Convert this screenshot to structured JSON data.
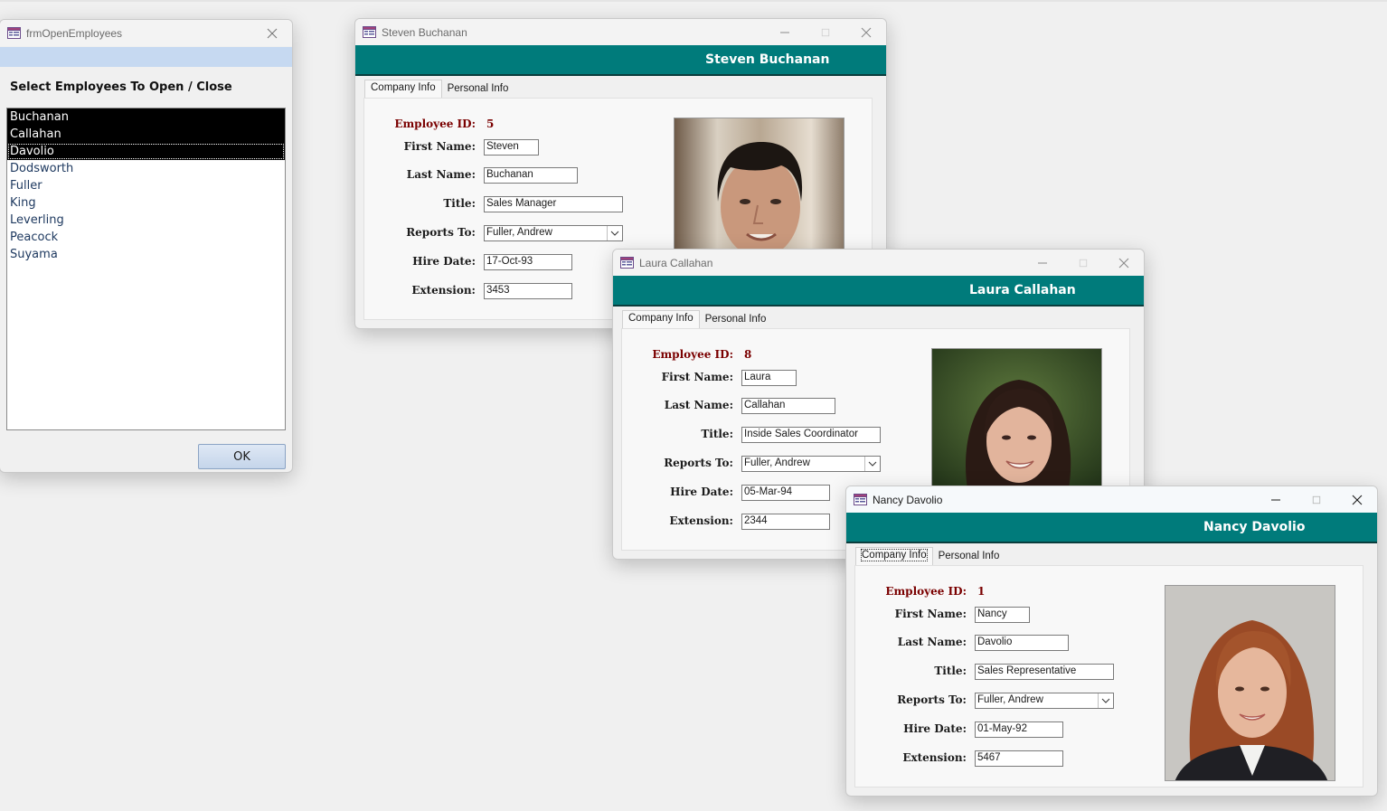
{
  "colors": {
    "header_teal": "#007b7b",
    "employee_id_red": "#7a0000",
    "list_selection": "#000000",
    "prompt_band": "#c6d9f1"
  },
  "open_employees_form": {
    "title": "frmOpenEmployees",
    "prompt": "Select Employees To Open / Close",
    "list_items": [
      {
        "name": "Buchanan",
        "selected": true
      },
      {
        "name": "Callahan",
        "selected": true
      },
      {
        "name": "Davolio",
        "selected": true
      },
      {
        "name": "Dodsworth",
        "selected": false
      },
      {
        "name": "Fuller",
        "selected": false
      },
      {
        "name": "King",
        "selected": false
      },
      {
        "name": "Leverling",
        "selected": false
      },
      {
        "name": "Peacock",
        "selected": false
      },
      {
        "name": "Suyama",
        "selected": false
      }
    ],
    "ok_label": "OK"
  },
  "labels": {
    "employee_id": "Employee ID:",
    "first_name": "First Name:",
    "last_name": "Last Name:",
    "title": "Title:",
    "reports_to": "Reports To:",
    "hire_date": "Hire Date:",
    "extension": "Extension:",
    "tab_company": "Company Info",
    "tab_personal": "Personal Info"
  },
  "employees": {
    "buchanan": {
      "window_title": "Steven Buchanan",
      "header_name": "Steven Buchanan",
      "employee_id": "5",
      "first_name": "Steven",
      "last_name": "Buchanan",
      "title": "Sales Manager",
      "reports_to": "Fuller, Andrew",
      "hire_date": "17-Oct-93",
      "extension": "3453"
    },
    "callahan": {
      "window_title": "Laura Callahan",
      "header_name": "Laura Callahan",
      "employee_id": "8",
      "first_name": "Laura",
      "last_name": "Callahan",
      "title": "Inside Sales Coordinator",
      "reports_to": "Fuller, Andrew",
      "hire_date": "05-Mar-94",
      "extension": "2344"
    },
    "davolio": {
      "window_title": "Nancy Davolio",
      "header_name": "Nancy Davolio",
      "employee_id": "1",
      "first_name": "Nancy",
      "last_name": "Davolio",
      "title": "Sales Representative",
      "reports_to": "Fuller, Andrew",
      "hire_date": "01-May-92",
      "extension": "5467"
    }
  }
}
